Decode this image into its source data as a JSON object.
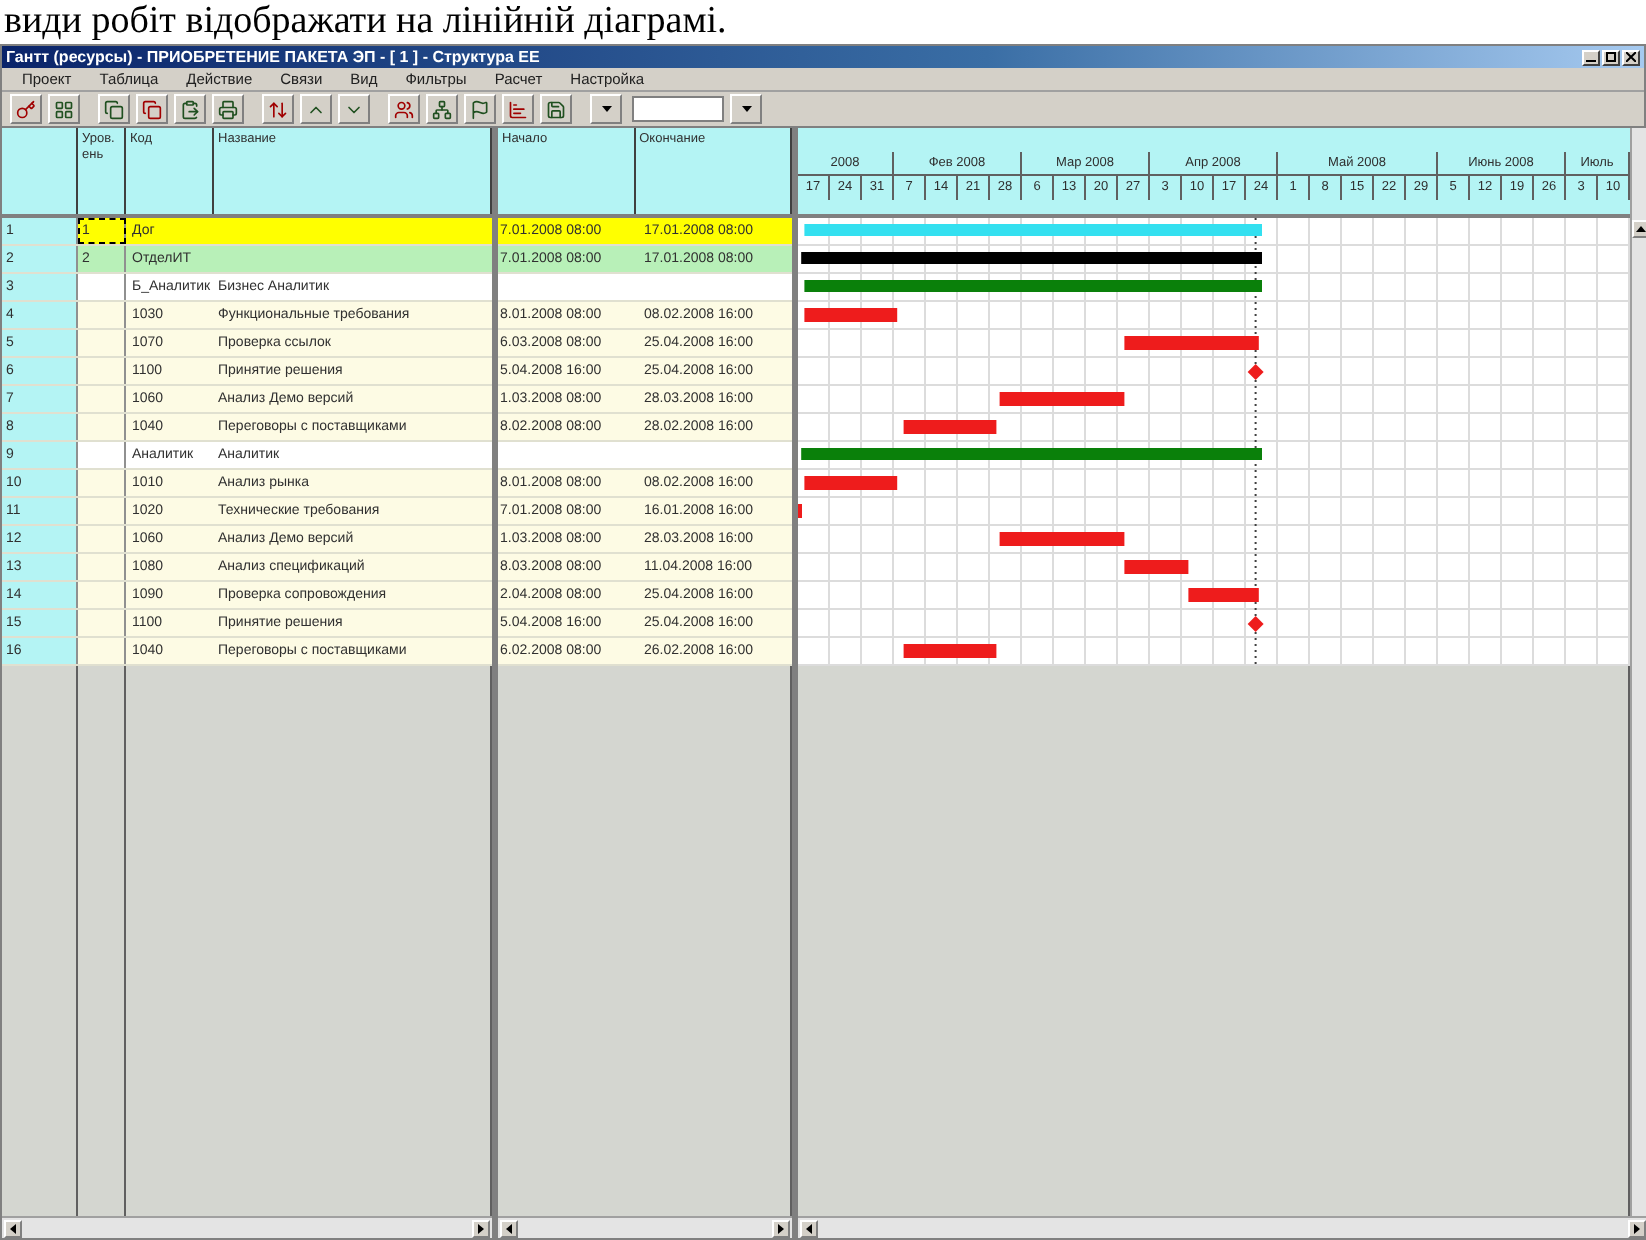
{
  "document_text": "види робіт відображати на лінійній діаграмі.",
  "window": {
    "title": "Гантт (ресурсы) - ПРИОБРЕТЕНИЕ ПАКЕТА ЭП - [ 1 ] - Структура ЕЕ"
  },
  "menu": [
    "Проект",
    "Таблица",
    "Действие",
    "Связи",
    "Вид",
    "Фильтры",
    "Расчет",
    "Настройка"
  ],
  "table": {
    "columns": [
      "Уров. ень",
      "Код",
      "Название",
      "Начало",
      "Окончание"
    ],
    "rows": [
      {
        "number": "1",
        "level": "1",
        "code": "Дог",
        "name": "",
        "start": "7.01.2008 08:00",
        "end": "17.01.2008 08:00",
        "kind": "project",
        "focused": true
      },
      {
        "number": "2",
        "level": "2",
        "code": "ОтделИТ",
        "name": "",
        "start": "7.01.2008 08:00",
        "end": "17.01.2008 08:00",
        "kind": "department",
        "focused": false
      },
      {
        "number": "3",
        "level": "",
        "code": "Б_Аналитик",
        "name": "Бизнес Аналитик",
        "start": "",
        "end": "",
        "kind": "resource",
        "focused": false
      },
      {
        "number": "4",
        "level": "",
        "code": "1030",
        "name": "Функциональные требования",
        "start": "8.01.2008 08:00",
        "end": "08.02.2008 16:00",
        "kind": "task",
        "focused": false
      },
      {
        "number": "5",
        "level": "",
        "code": "1070",
        "name": "Проверка ссылок",
        "start": "6.03.2008 08:00",
        "end": "25.04.2008 16:00",
        "kind": "task",
        "focused": false
      },
      {
        "number": "6",
        "level": "",
        "code": "1100",
        "name": "Принятие решения",
        "start": "5.04.2008 16:00",
        "end": "25.04.2008 16:00",
        "kind": "milestone",
        "focused": false
      },
      {
        "number": "7",
        "level": "",
        "code": "1060",
        "name": "Анализ Демо версий",
        "start": "1.03.2008 08:00",
        "end": "28.03.2008 16:00",
        "kind": "task",
        "focused": false
      },
      {
        "number": "8",
        "level": "",
        "code": "1040",
        "name": "Переговоры с поставщиками",
        "start": "8.02.2008 08:00",
        "end": "28.02.2008 16:00",
        "kind": "task",
        "focused": false
      },
      {
        "number": "9",
        "level": "",
        "code": "Аналитик",
        "name": "Аналитик",
        "start": "",
        "end": "",
        "kind": "resource",
        "focused": false
      },
      {
        "number": "10",
        "level": "",
        "code": "1010",
        "name": "Анализ рынка",
        "start": "8.01.2008 08:00",
        "end": "08.02.2008 16:00",
        "kind": "task",
        "focused": false
      },
      {
        "number": "11",
        "level": "",
        "code": "1020",
        "name": "Технические требования",
        "start": "7.01.2008 08:00",
        "end": "16.01.2008 16:00",
        "kind": "task",
        "focused": false
      },
      {
        "number": "12",
        "level": "",
        "code": "1060",
        "name": "Анализ Демо версий",
        "start": "1.03.2008 08:00",
        "end": "28.03.2008 16:00",
        "kind": "task",
        "focused": false
      },
      {
        "number": "13",
        "level": "",
        "code": "1080",
        "name": "Анализ спецификаций",
        "start": "8.03.2008 08:00",
        "end": "11.04.2008 16:00",
        "kind": "task",
        "focused": false
      },
      {
        "number": "14",
        "level": "",
        "code": "1090",
        "name": "Проверка сопровождения",
        "start": "2.04.2008 08:00",
        "end": "25.04.2008 16:00",
        "kind": "task",
        "focused": false
      },
      {
        "number": "15",
        "level": "",
        "code": "1100",
        "name": "Принятие решения",
        "start": "5.04.2008 16:00",
        "end": "25.04.2008 16:00",
        "kind": "milestone",
        "focused": false
      },
      {
        "number": "16",
        "level": "",
        "code": "1040",
        "name": "Переговоры с поставщиками",
        "start": "6.02.2008 08:00",
        "end": "26.02.2008 16:00",
        "kind": "task",
        "focused": false
      }
    ]
  },
  "timeline": {
    "months": [
      {
        "label": "2008",
        "days": [
          "17",
          "24",
          "31"
        ]
      },
      {
        "label": "Фев 2008",
        "days": [
          "7",
          "14",
          "21",
          "28"
        ]
      },
      {
        "label": "Мар 2008",
        "days": [
          "6",
          "13",
          "20",
          "27"
        ]
      },
      {
        "label": "Апр 2008",
        "days": [
          "3",
          "10",
          "17",
          "24"
        ]
      },
      {
        "label": "Май 2008",
        "days": [
          "1",
          "8",
          "15",
          "22",
          "29"
        ]
      },
      {
        "label": "Июнь 2008",
        "days": [
          "5",
          "12",
          "19",
          "26"
        ]
      },
      {
        "label": "Июль",
        "days": [
          "3",
          "10"
        ]
      }
    ]
  }
}
